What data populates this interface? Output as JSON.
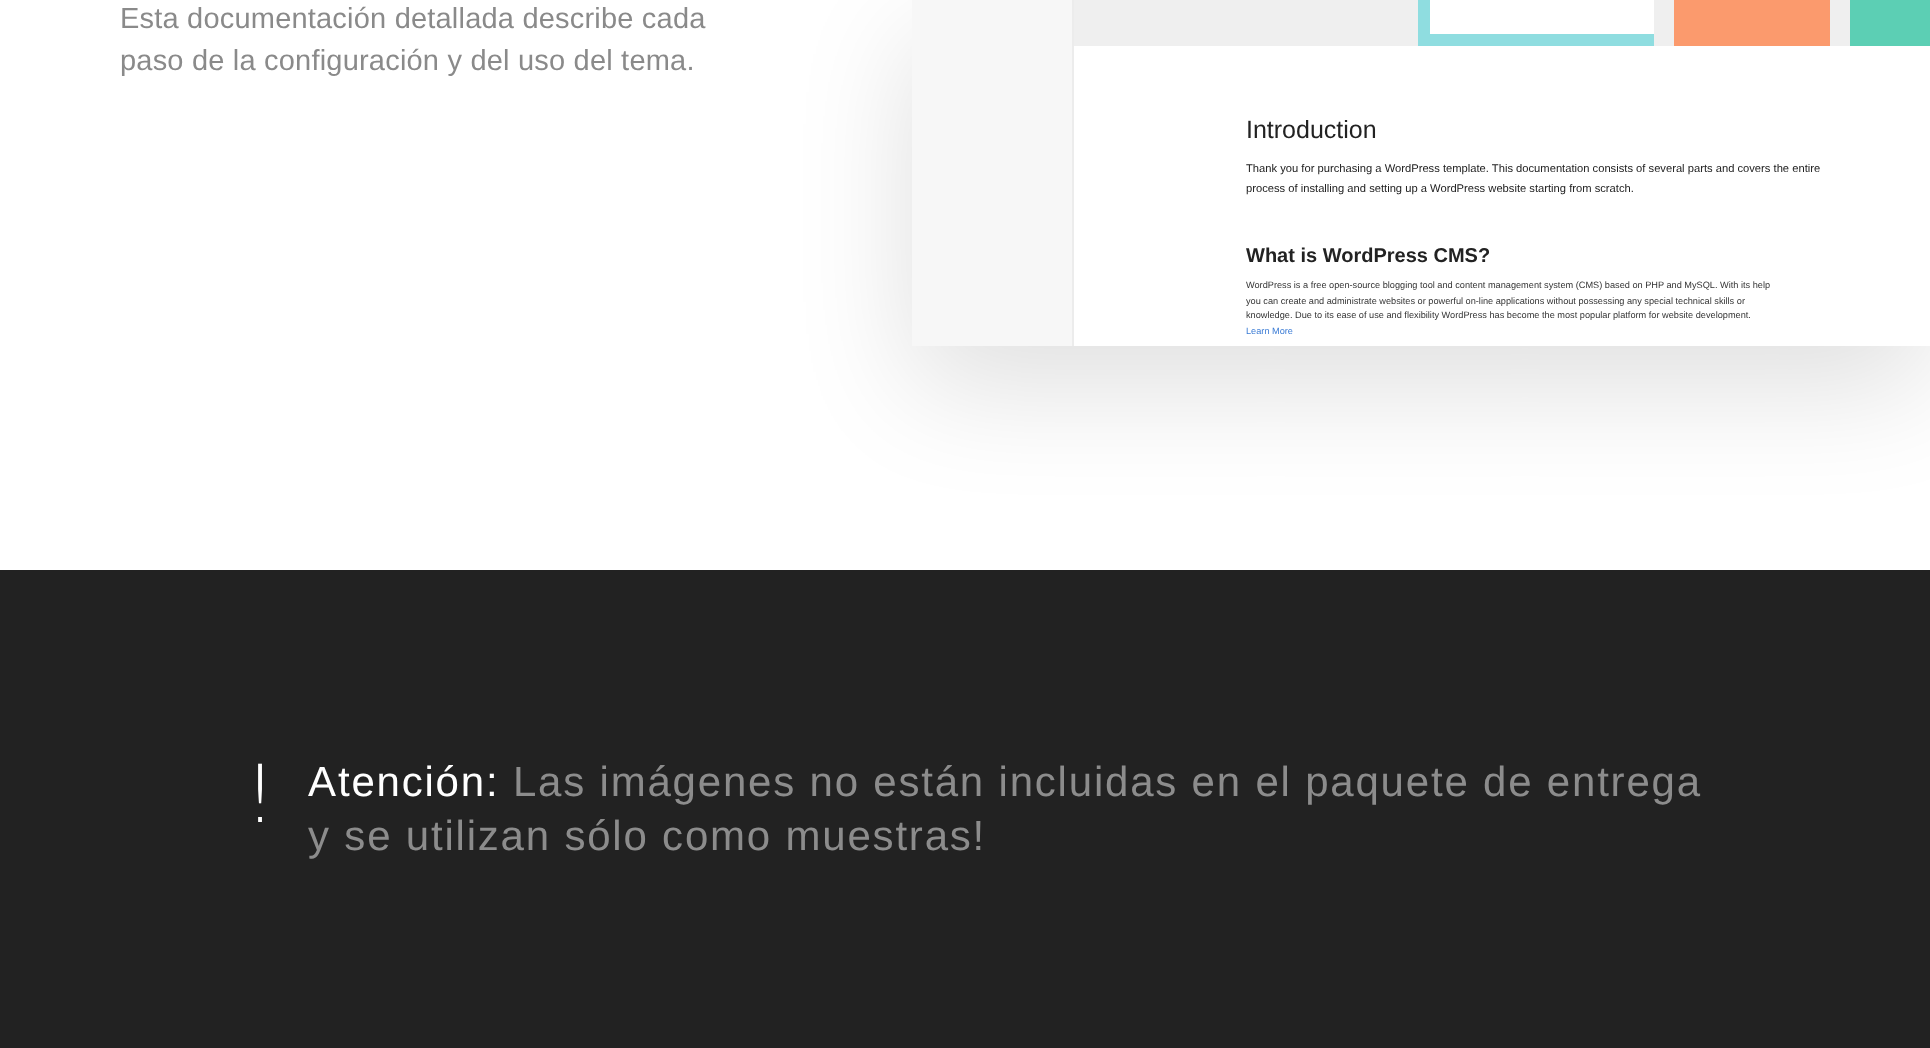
{
  "intro": {
    "text": "Esta documentación detallada describe cada paso de la configuración y del uso del tema."
  },
  "preview": {
    "heading": "Introduction",
    "intro_text": "Thank you for purchasing a WordPress template. This documentation consists of several parts and covers the entire process of installing and setting up a WordPress website starting from scratch.",
    "subheading": "What is WordPress CMS?",
    "body_text": "WordPress is a free open-source blogging tool and content management system (CMS) based on PHP and MySQL. With its help you can create and administrate websites or powerful on-line applications without possessing any special technical skills or knowledge. Due to its ease of use and flexibility WordPress has become the most popular platform for website development.",
    "link": "Learn More",
    "thumbnails": [
      {
        "color": "#8fdde0"
      },
      {
        "color": "#fb9a6d"
      },
      {
        "color": "#5ccfb4"
      }
    ]
  },
  "notice": {
    "mark": "!",
    "label": "Atención:",
    "message": "Las imágenes no están incluidas en el paquete de entrega y se utilizan sólo como muestras!"
  }
}
